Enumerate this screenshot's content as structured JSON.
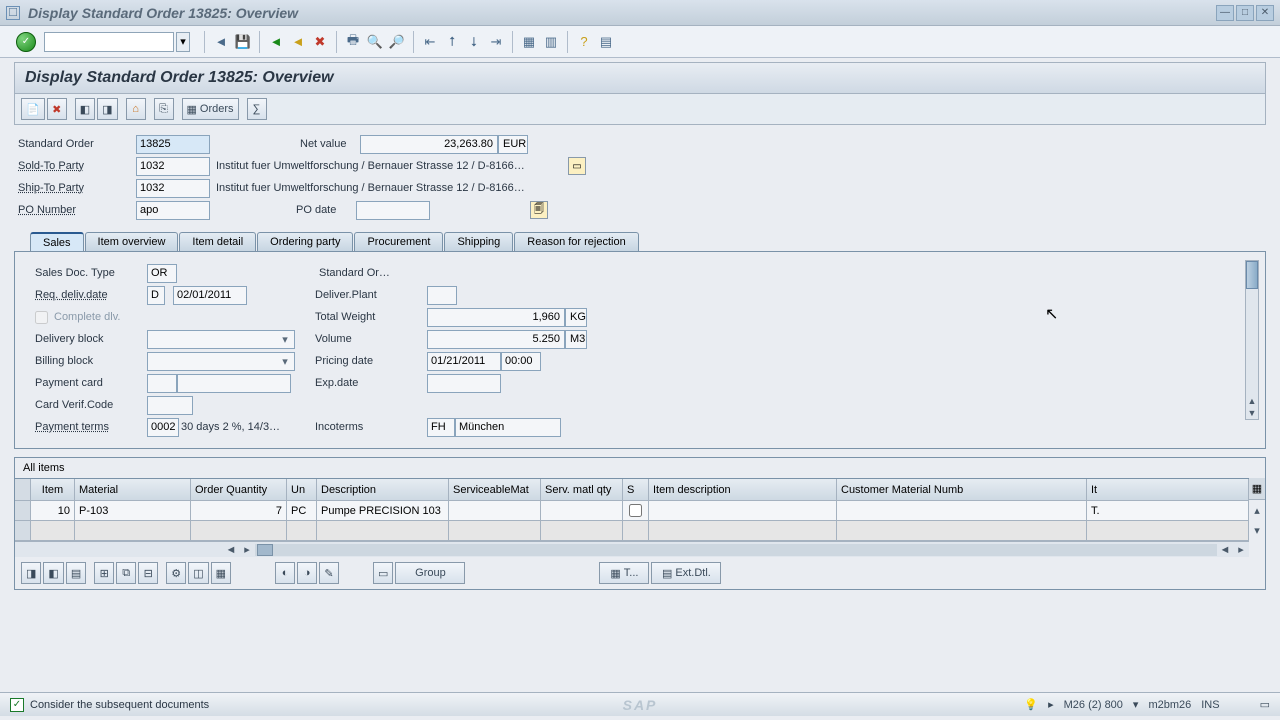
{
  "window": {
    "title": "Display Standard Order 13825: Overview"
  },
  "screen": {
    "title": "Display Standard Order 13825: Overview"
  },
  "header": {
    "standard_order_lbl": "Standard Order",
    "standard_order": "13825",
    "net_value_lbl": "Net value",
    "net_value": "23,263.80",
    "currency": "EUR",
    "sold_to_lbl": "Sold-To Party",
    "sold_to": "1032",
    "sold_to_text": "Institut fuer Umweltforschung / Bernauer Strasse 12 / D-8166…",
    "ship_to_lbl": "Ship-To Party",
    "ship_to": "1032",
    "ship_to_text": "Institut fuer Umweltforschung / Bernauer Strasse 12 / D-8166…",
    "po_number_lbl": "PO Number",
    "po_number": "apo",
    "po_date_lbl": "PO date",
    "po_date": ""
  },
  "tabs": [
    "Sales",
    "Item overview",
    "Item detail",
    "Ordering party",
    "Procurement",
    "Shipping",
    "Reason for rejection"
  ],
  "sales": {
    "doc_type_lbl": "Sales Doc. Type",
    "doc_type": "OR",
    "doc_type_text": "Standard Or…",
    "req_deliv_date_lbl": "Req. deliv.date",
    "req_deliv_rule": "D",
    "req_deliv_date": "02/01/2011",
    "complete_dlv_lbl": "Complete dlv.",
    "delivery_block_lbl": "Delivery block",
    "delivery_block": "",
    "billing_block_lbl": "Billing block",
    "billing_block": "",
    "payment_card_lbl": "Payment card",
    "payment_card_type": "",
    "payment_card": "",
    "card_verif_lbl": "Card Verif.Code",
    "card_verif": "",
    "payment_terms_lbl": "Payment terms",
    "payment_terms": "0002",
    "payment_terms_text": "30 days 2 %, 14/3…",
    "deliv_plant_lbl": "Deliver.Plant",
    "deliv_plant": "",
    "total_weight_lbl": "Total Weight",
    "total_weight": "1,960",
    "weight_unit": "KG",
    "volume_lbl": "Volume",
    "volume": "5.250",
    "volume_unit": "M3",
    "pricing_date_lbl": "Pricing date",
    "pricing_date": "01/21/2011",
    "pricing_time": "00:00",
    "exp_date_lbl": "Exp.date",
    "exp_date": "",
    "incoterms_lbl": "Incoterms",
    "incoterms": "FH",
    "incoterms_loc": "München"
  },
  "items": {
    "title": "All items",
    "columns": [
      "Item",
      "Material",
      "Order Quantity",
      "Un",
      "Description",
      "ServiceableMat",
      "Serv. matl qty",
      "S",
      "Item description",
      "Customer Material Numb",
      "It"
    ],
    "rows": [
      {
        "item": "10",
        "material": "P-103",
        "qty": "7",
        "un": "PC",
        "desc": "Pumpe PRECISION 103",
        "servmat": "",
        "servqty": "",
        "s": false,
        "itemdesc": "",
        "custmat": "",
        "it": "T."
      }
    ]
  },
  "bottom_buttons": {
    "group": "Group",
    "t": "T...",
    "extdtl": "Ext.Dtl."
  },
  "app_toolbar": {
    "orders": "Orders"
  },
  "status": {
    "message": "Consider the subsequent documents",
    "session": "M26 (2) 800",
    "server": "m2bm26",
    "mode": "INS"
  }
}
